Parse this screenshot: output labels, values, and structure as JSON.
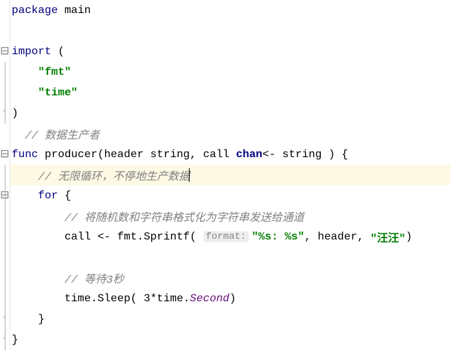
{
  "code": {
    "line1": {
      "kw_package": "package",
      "name": "main"
    },
    "line3": {
      "kw_import": "import",
      "paren": "("
    },
    "line4": {
      "str": "\"fmt\""
    },
    "line5": {
      "str": "\"time\""
    },
    "line6": {
      "paren": ")"
    },
    "line7": {
      "comment": "// 数据生产者"
    },
    "line8": {
      "kw_func": "func",
      "fname": "producer",
      "paren_open": "(",
      "param1": "header",
      "type1": "string",
      "comma": ",",
      "param2": "call",
      "chan_kw": "chan",
      "arrow": "<-",
      "type2": "string",
      "paren_close": ")",
      "brace": "{"
    },
    "line9": {
      "comment": "// 无限循环，不停地生产数据"
    },
    "line10": {
      "kw_for": "for",
      "brace": "{"
    },
    "line11": {
      "comment": "// 将随机数和字符串格式化为字符串发送给通道"
    },
    "line12": {
      "ident": "call",
      "arrow": "<-",
      "pkg": "fmt",
      "dot": ".",
      "fn": "Sprintf",
      "paren_open": "(",
      "hint": "format:",
      "fmt_str": "\"%s: %s\"",
      "comma1": ",",
      "arg1": "header",
      "comma2": ",",
      "arg2": "\"汪汪\"",
      "paren_close": ")"
    },
    "line14": {
      "comment": "// 等待3秒"
    },
    "line15": {
      "pkg": "time",
      "dot1": ".",
      "fn": "Sleep",
      "paren_open": "(",
      "num": "3",
      "star": "*",
      "pkg2": "time",
      "dot2": ".",
      "const": "Second",
      "paren_close": ")"
    },
    "line16": {
      "brace": "}"
    },
    "line17": {
      "brace": "}"
    }
  }
}
